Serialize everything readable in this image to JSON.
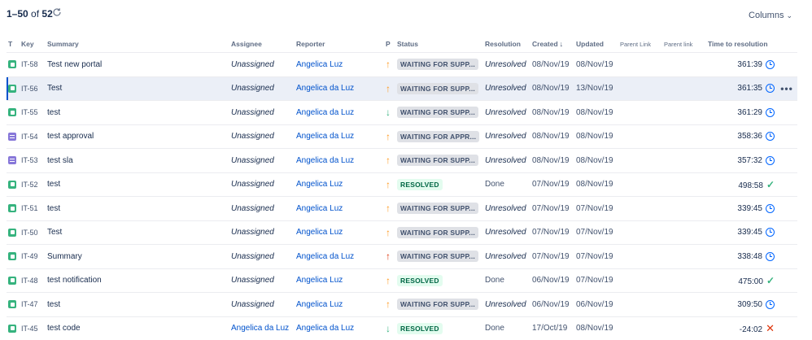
{
  "pagination": {
    "range": "1–50",
    "of_label": "of",
    "total": "52"
  },
  "toolbar": {
    "columns_label": "Columns"
  },
  "headers": {
    "type": "T",
    "key": "Key",
    "summary": "Summary",
    "assignee": "Assignee",
    "reporter": "Reporter",
    "priority": "P",
    "status": "Status",
    "resolution": "Resolution",
    "created": "Created",
    "updated": "Updated",
    "parent_link_1": "Parent Link",
    "parent_link_2": "Parent link",
    "time_to_resolution": "Time to resolution"
  },
  "rows": [
    {
      "type": "story",
      "key": "IT-58",
      "summary": "Test new portal",
      "assignee": "Unassigned",
      "reporter": "Angelica Luz",
      "priority": "up",
      "status": "WAITING FOR SUPP...",
      "resolution": "Unresolved",
      "created": "08/Nov/19",
      "updated": "08/Nov/19",
      "time": "361:39",
      "sla": "clock"
    },
    {
      "type": "story",
      "key": "IT-56",
      "summary": "Test",
      "assignee": "Unassigned",
      "reporter": "Angelica da Luz",
      "priority": "up",
      "status": "WAITING FOR SUPP...",
      "resolution": "Unresolved",
      "created": "08/Nov/19",
      "updated": "13/Nov/19",
      "time": "361:35",
      "sla": "clock"
    },
    {
      "type": "story",
      "key": "IT-55",
      "summary": "test",
      "assignee": "Unassigned",
      "reporter": "Angelica da Luz",
      "priority": "down",
      "status": "WAITING FOR SUPP...",
      "resolution": "Unresolved",
      "created": "08/Nov/19",
      "updated": "08/Nov/19",
      "time": "361:29",
      "sla": "clock"
    },
    {
      "type": "approval",
      "key": "IT-54",
      "summary": "test approval",
      "assignee": "Unassigned",
      "reporter": "Angelica da Luz",
      "priority": "up",
      "status": "WAITING FOR APPR...",
      "resolution": "Unresolved",
      "created": "08/Nov/19",
      "updated": "08/Nov/19",
      "time": "358:36",
      "sla": "clock"
    },
    {
      "type": "approval",
      "key": "IT-53",
      "summary": "test sla",
      "assignee": "Unassigned",
      "reporter": "Angelica da Luz",
      "priority": "up",
      "status": "WAITING FOR SUPP...",
      "resolution": "Unresolved",
      "created": "08/Nov/19",
      "updated": "08/Nov/19",
      "time": "357:32",
      "sla": "clock"
    },
    {
      "type": "story",
      "key": "IT-52",
      "summary": "test",
      "assignee": "Unassigned",
      "reporter": "Angelica Luz",
      "priority": "up",
      "status": "RESOLVED",
      "resolution": "Done",
      "created": "07/Nov/19",
      "updated": "08/Nov/19",
      "time": "498:58",
      "sla": "check"
    },
    {
      "type": "story",
      "key": "IT-51",
      "summary": "test",
      "assignee": "Unassigned",
      "reporter": "Angelica Luz",
      "priority": "up",
      "status": "WAITING FOR SUPP...",
      "resolution": "Unresolved",
      "created": "07/Nov/19",
      "updated": "07/Nov/19",
      "time": "339:45",
      "sla": "clock"
    },
    {
      "type": "story",
      "key": "IT-50",
      "summary": "Test",
      "assignee": "Unassigned",
      "reporter": "Angelica Luz",
      "priority": "up",
      "status": "WAITING FOR SUPP...",
      "resolution": "Unresolved",
      "created": "07/Nov/19",
      "updated": "07/Nov/19",
      "time": "339:45",
      "sla": "clock"
    },
    {
      "type": "story",
      "key": "IT-49",
      "summary": "Summary",
      "assignee": "Unassigned",
      "reporter": "Angelica da Luz",
      "priority": "high",
      "status": "WAITING FOR SUPP...",
      "resolution": "Unresolved",
      "created": "07/Nov/19",
      "updated": "07/Nov/19",
      "time": "338:48",
      "sla": "clock"
    },
    {
      "type": "story",
      "key": "IT-48",
      "summary": "test notification",
      "assignee": "Unassigned",
      "reporter": "Angelica Luz",
      "priority": "up",
      "status": "RESOLVED",
      "resolution": "Done",
      "created": "06/Nov/19",
      "updated": "07/Nov/19",
      "time": "475:00",
      "sla": "check"
    },
    {
      "type": "story",
      "key": "IT-47",
      "summary": "test",
      "assignee": "Unassigned",
      "reporter": "Angelica Luz",
      "priority": "up",
      "status": "WAITING FOR SUPP...",
      "resolution": "Unresolved",
      "created": "06/Nov/19",
      "updated": "06/Nov/19",
      "time": "309:50",
      "sla": "clock"
    },
    {
      "type": "story",
      "key": "IT-45",
      "summary": "test code",
      "assignee": "Angelica da Luz",
      "reporter": "Angelica da Luz",
      "priority": "down",
      "status": "RESOLVED",
      "resolution": "Done",
      "created": "17/Oct/19",
      "updated": "08/Nov/19",
      "time": "-24:02",
      "sla": "cross"
    }
  ],
  "selected_row_index": 1,
  "row_actions_label": "•••",
  "colors": {
    "accent": "#0052cc",
    "success": "#36b37e",
    "danger": "#de350b",
    "warning": "#ff991f",
    "sla_clock": "#0065ff"
  }
}
